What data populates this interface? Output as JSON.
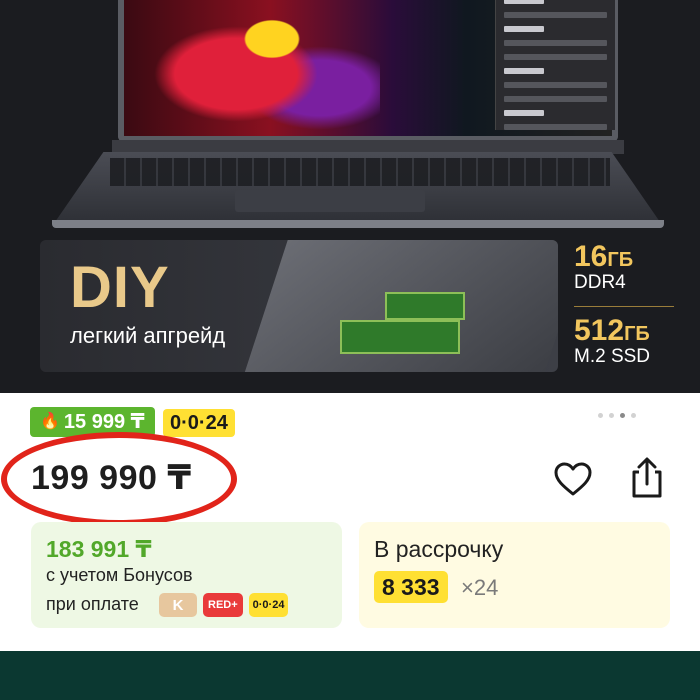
{
  "banner": {
    "diy_title": "DIY",
    "diy_subtitle": "легкий апгрейд",
    "specs": [
      {
        "value": "16",
        "unit": "ГБ",
        "label": "DDR4"
      },
      {
        "value": "512",
        "unit": "ГБ",
        "label": "M.2 SSD"
      }
    ]
  },
  "gallery": {
    "dot_count": 4,
    "active_dot": 3
  },
  "badges": {
    "bonus": "15 999 ₸",
    "installment": "0·0·24"
  },
  "price": {
    "current": "199 990 ₸",
    "highlight_color": "#e1241a"
  },
  "actions": {
    "favorite_icon": "heart-icon",
    "share_icon": "share-icon"
  },
  "bonus_card": {
    "amount": "183 991 ₸",
    "line1": "с учетом Бонусов",
    "line2": "при оплате",
    "pay_badges": {
      "kaspi": "K",
      "red": "RED+",
      "installment": "0·0·24"
    }
  },
  "installment_card": {
    "label": "В рассрочку",
    "monthly": "8 333",
    "term": "×24"
  },
  "colors": {
    "bonus_green": "#5cb52e",
    "installment_yellow": "#ffe033",
    "footer_bar": "#0b3831"
  }
}
